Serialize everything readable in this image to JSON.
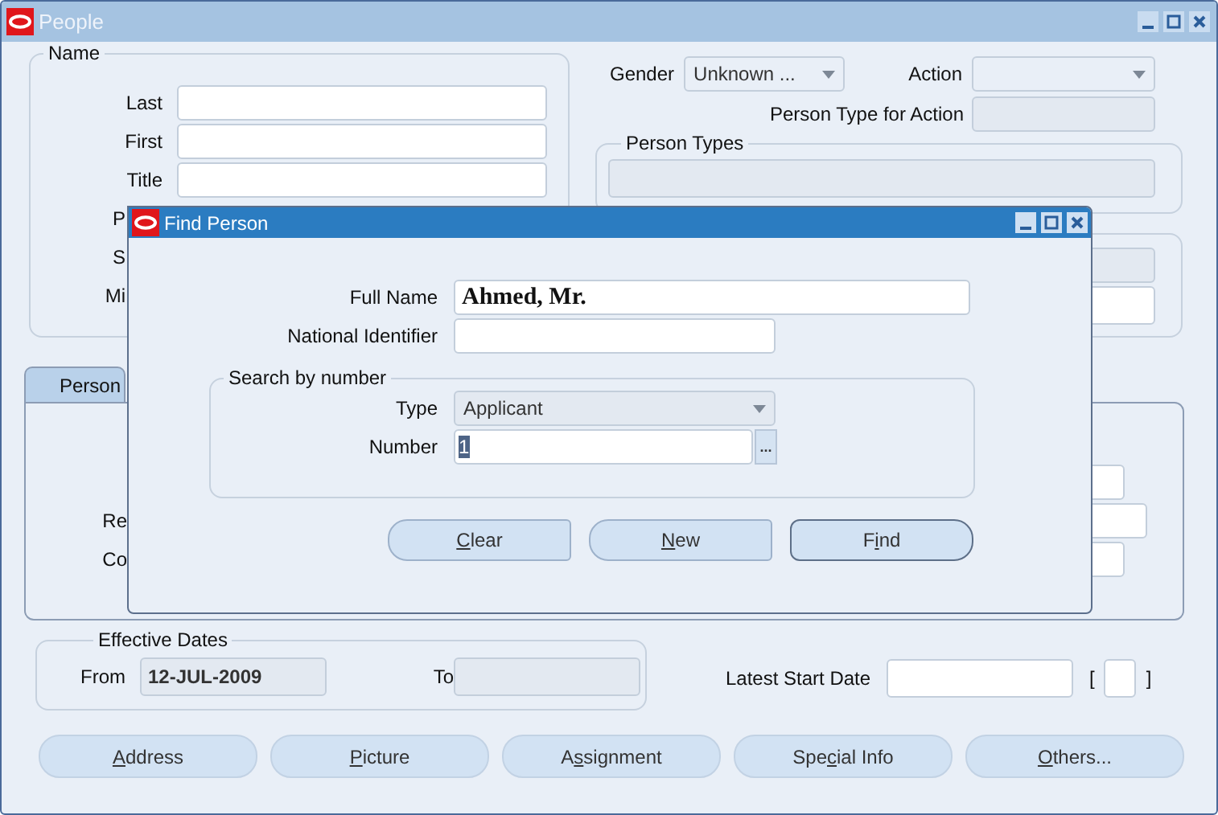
{
  "window": {
    "title": "People"
  },
  "name_group": {
    "title": "Name",
    "rows": [
      {
        "label": "Last",
        "kind": "input"
      },
      {
        "label": "First",
        "kind": "input"
      },
      {
        "label": "Title",
        "kind": "input"
      },
      {
        "label": "P",
        "kind": "cut"
      },
      {
        "label": "S",
        "kind": "cut"
      },
      {
        "label": "Mi",
        "kind": "cut"
      }
    ]
  },
  "gender": {
    "label": "Gender",
    "value": "Unknown ..."
  },
  "action": {
    "label": "Action"
  },
  "person_type_for_action": {
    "label": "Person Type for Action"
  },
  "person_types": {
    "title": "Person Types"
  },
  "tabs": [
    {
      "label": "Person",
      "selected": true
    }
  ],
  "tab_panel": {
    "rows": [
      {},
      {
        "label": "Re"
      },
      {
        "label": "Co"
      }
    ]
  },
  "effective_dates": {
    "title": "Effective Dates",
    "from_label": "From",
    "from_value": "12-JUL-2009",
    "to_label": "To"
  },
  "latest_start_date": {
    "label": "Latest Start Date",
    "bracket_open": "[",
    "bracket_close": "]"
  },
  "buttons": [
    {
      "key": "A",
      "after": "ddress"
    },
    {
      "key": "P",
      "after": "icture"
    },
    {
      "before": "A",
      "key": "s",
      "after": "signment"
    },
    {
      "before": "Spe",
      "key": "c",
      "after": "ial Info"
    },
    {
      "key": "O",
      "after": "thers..."
    }
  ],
  "dialog": {
    "title": "Find Person",
    "full_name": {
      "label": "Full Name",
      "value": "Ahmed, Mr."
    },
    "national_identifier": {
      "label": "National Identifier"
    },
    "search_by_number": {
      "title": "Search by number",
      "type": {
        "label": "Type",
        "value": "Applicant"
      },
      "number": {
        "label": "Number",
        "value": "1",
        "highlighted": true
      },
      "lov_button": "..."
    },
    "buttons": [
      {
        "key": "C",
        "after": "lear",
        "default": false
      },
      {
        "key": "N",
        "after": "ew",
        "default": false
      },
      {
        "before": "F",
        "key": "i",
        "after": "nd",
        "default": true
      }
    ]
  }
}
